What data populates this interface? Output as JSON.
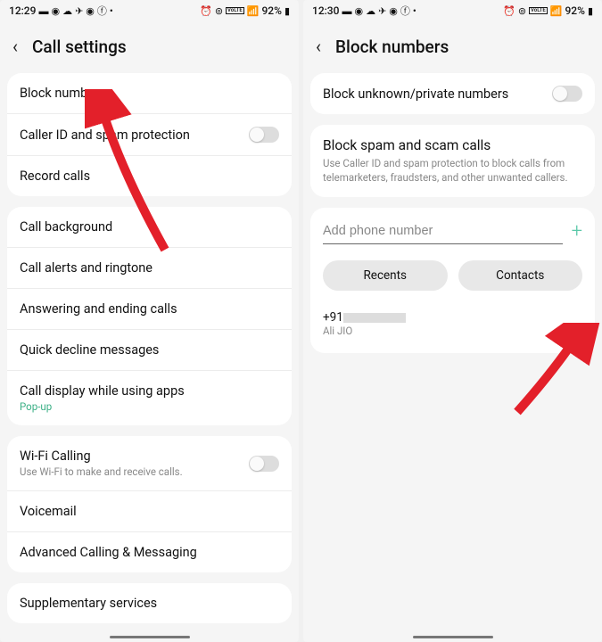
{
  "status": {
    "time_left": "12:29",
    "time_right": "12:30",
    "battery": "92%",
    "vol": "VoLTE"
  },
  "left": {
    "title": "Call settings",
    "items": {
      "block_numbers": "Block numbers",
      "caller_id": "Caller ID and spam protection",
      "record": "Record calls",
      "background": "Call background",
      "alerts": "Call alerts and ringtone",
      "answering": "Answering and ending calls",
      "decline": "Quick decline messages",
      "display": "Call display while using apps",
      "display_sub": "Pop-up",
      "wifi": "Wi-Fi Calling",
      "wifi_sub": "Use Wi-Fi to make and receive calls.",
      "voicemail": "Voicemail",
      "advanced": "Advanced Calling & Messaging",
      "supplementary": "Supplementary services"
    }
  },
  "right": {
    "title": "Block numbers",
    "block_unknown": "Block unknown/private numbers",
    "spam_title": "Block spam and scam calls",
    "spam_desc": "Use Caller ID and spam protection to block calls from telemarketers, fraudsters, and other unwanted callers.",
    "input_placeholder": "Add phone number",
    "recents": "Recents",
    "contacts": "Contacts",
    "blocked_number": "+91",
    "blocked_name": "Ali JIO"
  }
}
